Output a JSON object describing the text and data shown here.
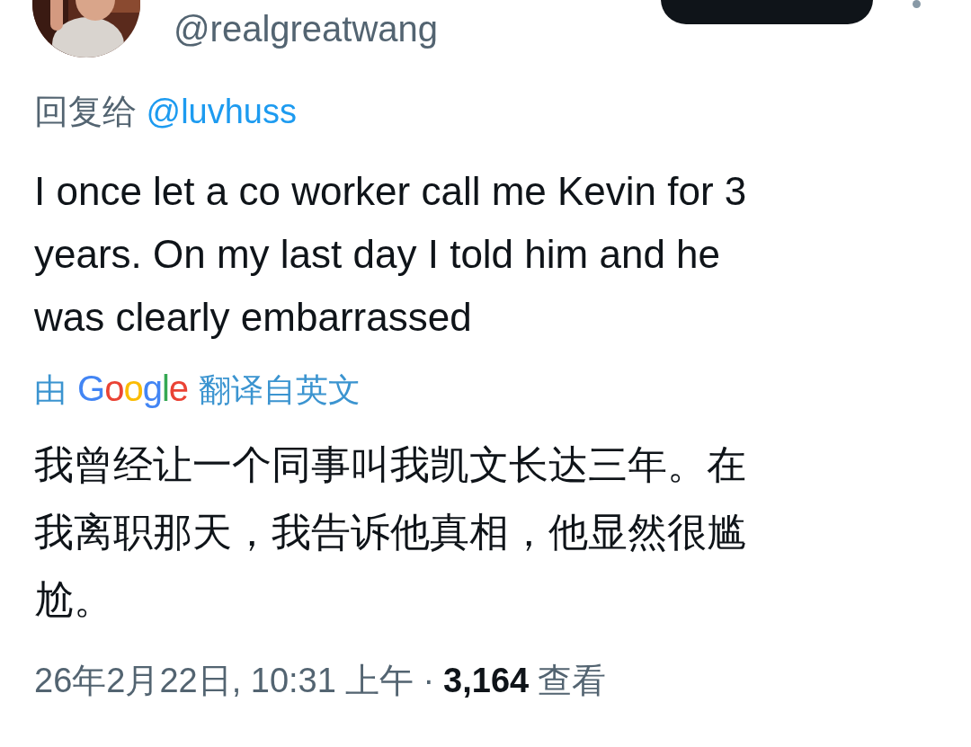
{
  "author": {
    "handle": "@realgreatwang"
  },
  "reply_to": {
    "label": "回复给",
    "handle": "@luvhuss"
  },
  "tweet_lines": [
    "I once let a co worker call me Kevin for 3",
    "years. On my last day I told him and he",
    "was clearly embarrassed"
  ],
  "translation": {
    "prefix": "由",
    "brand": "Google",
    "suffix": "翻译自英文"
  },
  "translated_lines": [
    "我曾经让一个同事叫我凯文长达三年。在",
    "我离职那天，我告诉他真相，他显然很尴",
    "尬。"
  ],
  "meta": {
    "timestamp": "26年2月22日, 10:31 上午",
    "separator": "·",
    "views": "3,164",
    "views_label": "查看"
  }
}
